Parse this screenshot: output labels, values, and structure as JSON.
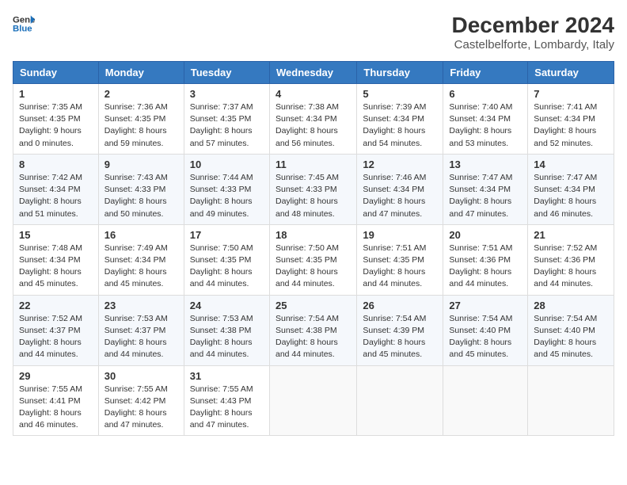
{
  "header": {
    "logo_line1": "General",
    "logo_line2": "Blue",
    "month": "December 2024",
    "location": "Castelbelforte, Lombardy, Italy"
  },
  "days_of_week": [
    "Sunday",
    "Monday",
    "Tuesday",
    "Wednesday",
    "Thursday",
    "Friday",
    "Saturday"
  ],
  "weeks": [
    [
      {
        "day": "1",
        "sunrise": "7:35 AM",
        "sunset": "4:35 PM",
        "daylight": "9 hours and 0 minutes."
      },
      {
        "day": "2",
        "sunrise": "7:36 AM",
        "sunset": "4:35 PM",
        "daylight": "8 hours and 59 minutes."
      },
      {
        "day": "3",
        "sunrise": "7:37 AM",
        "sunset": "4:35 PM",
        "daylight": "8 hours and 57 minutes."
      },
      {
        "day": "4",
        "sunrise": "7:38 AM",
        "sunset": "4:34 PM",
        "daylight": "8 hours and 56 minutes."
      },
      {
        "day": "5",
        "sunrise": "7:39 AM",
        "sunset": "4:34 PM",
        "daylight": "8 hours and 54 minutes."
      },
      {
        "day": "6",
        "sunrise": "7:40 AM",
        "sunset": "4:34 PM",
        "daylight": "8 hours and 53 minutes."
      },
      {
        "day": "7",
        "sunrise": "7:41 AM",
        "sunset": "4:34 PM",
        "daylight": "8 hours and 52 minutes."
      }
    ],
    [
      {
        "day": "8",
        "sunrise": "7:42 AM",
        "sunset": "4:34 PM",
        "daylight": "8 hours and 51 minutes."
      },
      {
        "day": "9",
        "sunrise": "7:43 AM",
        "sunset": "4:33 PM",
        "daylight": "8 hours and 50 minutes."
      },
      {
        "day": "10",
        "sunrise": "7:44 AM",
        "sunset": "4:33 PM",
        "daylight": "8 hours and 49 minutes."
      },
      {
        "day": "11",
        "sunrise": "7:45 AM",
        "sunset": "4:33 PM",
        "daylight": "8 hours and 48 minutes."
      },
      {
        "day": "12",
        "sunrise": "7:46 AM",
        "sunset": "4:34 PM",
        "daylight": "8 hours and 47 minutes."
      },
      {
        "day": "13",
        "sunrise": "7:47 AM",
        "sunset": "4:34 PM",
        "daylight": "8 hours and 47 minutes."
      },
      {
        "day": "14",
        "sunrise": "7:47 AM",
        "sunset": "4:34 PM",
        "daylight": "8 hours and 46 minutes."
      }
    ],
    [
      {
        "day": "15",
        "sunrise": "7:48 AM",
        "sunset": "4:34 PM",
        "daylight": "8 hours and 45 minutes."
      },
      {
        "day": "16",
        "sunrise": "7:49 AM",
        "sunset": "4:34 PM",
        "daylight": "8 hours and 45 minutes."
      },
      {
        "day": "17",
        "sunrise": "7:50 AM",
        "sunset": "4:35 PM",
        "daylight": "8 hours and 44 minutes."
      },
      {
        "day": "18",
        "sunrise": "7:50 AM",
        "sunset": "4:35 PM",
        "daylight": "8 hours and 44 minutes."
      },
      {
        "day": "19",
        "sunrise": "7:51 AM",
        "sunset": "4:35 PM",
        "daylight": "8 hours and 44 minutes."
      },
      {
        "day": "20",
        "sunrise": "7:51 AM",
        "sunset": "4:36 PM",
        "daylight": "8 hours and 44 minutes."
      },
      {
        "day": "21",
        "sunrise": "7:52 AM",
        "sunset": "4:36 PM",
        "daylight": "8 hours and 44 minutes."
      }
    ],
    [
      {
        "day": "22",
        "sunrise": "7:52 AM",
        "sunset": "4:37 PM",
        "daylight": "8 hours and 44 minutes."
      },
      {
        "day": "23",
        "sunrise": "7:53 AM",
        "sunset": "4:37 PM",
        "daylight": "8 hours and 44 minutes."
      },
      {
        "day": "24",
        "sunrise": "7:53 AM",
        "sunset": "4:38 PM",
        "daylight": "8 hours and 44 minutes."
      },
      {
        "day": "25",
        "sunrise": "7:54 AM",
        "sunset": "4:38 PM",
        "daylight": "8 hours and 44 minutes."
      },
      {
        "day": "26",
        "sunrise": "7:54 AM",
        "sunset": "4:39 PM",
        "daylight": "8 hours and 45 minutes."
      },
      {
        "day": "27",
        "sunrise": "7:54 AM",
        "sunset": "4:40 PM",
        "daylight": "8 hours and 45 minutes."
      },
      {
        "day": "28",
        "sunrise": "7:54 AM",
        "sunset": "4:40 PM",
        "daylight": "8 hours and 45 minutes."
      }
    ],
    [
      {
        "day": "29",
        "sunrise": "7:55 AM",
        "sunset": "4:41 PM",
        "daylight": "8 hours and 46 minutes."
      },
      {
        "day": "30",
        "sunrise": "7:55 AM",
        "sunset": "4:42 PM",
        "daylight": "8 hours and 47 minutes."
      },
      {
        "day": "31",
        "sunrise": "7:55 AM",
        "sunset": "4:43 PM",
        "daylight": "8 hours and 47 minutes."
      },
      null,
      null,
      null,
      null
    ]
  ],
  "labels": {
    "sunrise": "Sunrise:",
    "sunset": "Sunset:",
    "daylight": "Daylight:"
  }
}
